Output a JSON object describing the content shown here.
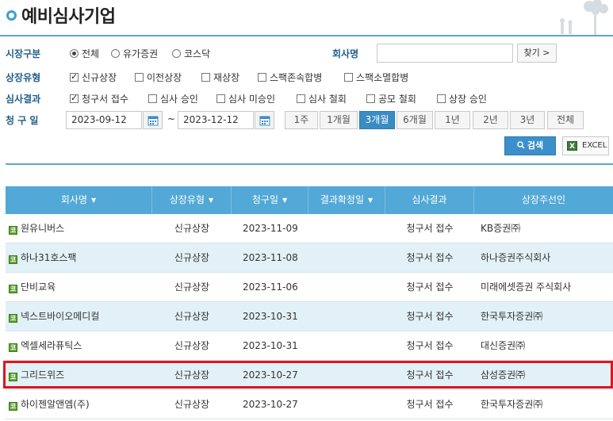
{
  "page": {
    "title": "예비심사기업"
  },
  "filters": {
    "market": {
      "label": "시장구분",
      "options": [
        {
          "label": "전체",
          "selected": true
        },
        {
          "label": "유가증권",
          "selected": false
        },
        {
          "label": "코스닥",
          "selected": false
        }
      ]
    },
    "company": {
      "label": "회사명",
      "value": "",
      "placeholder": "",
      "find_label": "찾기 >"
    },
    "listing_type": {
      "label": "상장유형",
      "options": [
        {
          "label": "신규상장",
          "checked": true
        },
        {
          "label": "이전상장",
          "checked": false
        },
        {
          "label": "재상장",
          "checked": false
        },
        {
          "label": "스팩존속합병",
          "checked": false
        },
        {
          "label": "스팩소멸합병",
          "checked": false
        }
      ]
    },
    "review_result": {
      "label": "심사결과",
      "options": [
        {
          "label": "청구서 접수",
          "checked": true
        },
        {
          "label": "심사 승인",
          "checked": false
        },
        {
          "label": "심사 미승인",
          "checked": false
        },
        {
          "label": "심사 철회",
          "checked": false
        },
        {
          "label": "공모 철회",
          "checked": false
        },
        {
          "label": "상장 승인",
          "checked": false
        }
      ]
    },
    "request_date": {
      "label": "청 구 일",
      "from": "2023-09-12",
      "separator": "~",
      "to": "2023-12-12",
      "periods": [
        "1주",
        "1개월",
        "3개월",
        "6개월",
        "1년",
        "2년",
        "3년",
        "전체"
      ],
      "active_period": "3개월"
    }
  },
  "actions": {
    "search_label": "검색",
    "excel_label": "EXCEL"
  },
  "table": {
    "columns": [
      "회사명",
      "상장유형",
      "청구일",
      "결과확정일",
      "심사결과",
      "상장주선인"
    ],
    "market_badge": "코",
    "rows": [
      {
        "company": "원유니버스",
        "type": "신규상장",
        "date": "2023-11-09",
        "confirm": "",
        "result": "청구서 접수",
        "underwriter": "KB증권㈜"
      },
      {
        "company": "하나31호스팩",
        "type": "신규상장",
        "date": "2023-11-08",
        "confirm": "",
        "result": "청구서 접수",
        "underwriter": "하나증권주식회사"
      },
      {
        "company": "단비교육",
        "type": "신규상장",
        "date": "2023-11-06",
        "confirm": "",
        "result": "청구서 접수",
        "underwriter": "미래에셋증권 주식회사"
      },
      {
        "company": "넥스트바이오메디컬",
        "type": "신규상장",
        "date": "2023-10-31",
        "confirm": "",
        "result": "청구서 접수",
        "underwriter": "한국투자증권㈜"
      },
      {
        "company": "엑셀세라퓨틱스",
        "type": "신규상장",
        "date": "2023-10-31",
        "confirm": "",
        "result": "청구서 접수",
        "underwriter": "대신증권㈜"
      },
      {
        "company": "그리드위즈",
        "type": "신규상장",
        "date": "2023-10-27",
        "confirm": "",
        "result": "청구서 접수",
        "underwriter": "삼성증권㈜"
      },
      {
        "company": "하이젠알앤엠(주)",
        "type": "신규상장",
        "date": "2023-10-27",
        "confirm": "",
        "result": "청구서 접수",
        "underwriter": "한국투자증권㈜"
      }
    ]
  },
  "colors": {
    "accent": "#52a8d6",
    "highlight": "#e0141b",
    "active_button": "#3a8cc4"
  }
}
